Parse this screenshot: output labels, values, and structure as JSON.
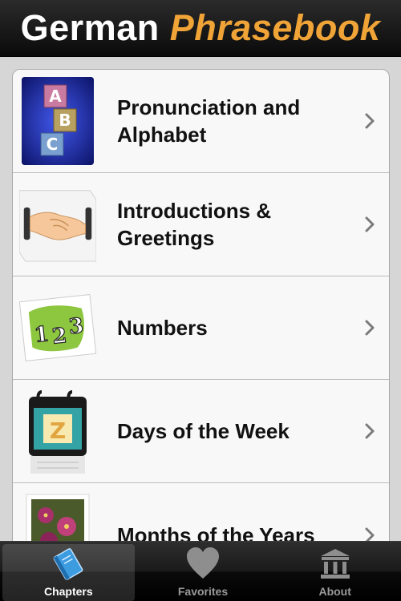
{
  "header": {
    "title_part1": "German",
    "title_part2": "Phrasebook"
  },
  "chapters": [
    {
      "label": "Pronunciation and Alphabet",
      "icon": "abc-blocks-icon"
    },
    {
      "label": "Introductions & Greetings",
      "icon": "handshake-icon"
    },
    {
      "label": "Numbers",
      "icon": "numbers-123-icon"
    },
    {
      "label": "Days of the Week",
      "icon": "calendar-icon"
    },
    {
      "label": "Months of the Years",
      "icon": "flowers-icon"
    }
  ],
  "tabbar": {
    "tabs": [
      {
        "label": "Chapters",
        "icon": "book-icon",
        "active": true
      },
      {
        "label": "Favorites",
        "icon": "heart-icon",
        "active": false
      },
      {
        "label": "About",
        "icon": "building-icon",
        "active": false
      }
    ]
  },
  "colors": {
    "accent_orange": "#f0a437",
    "header_bg": "#111111",
    "list_bg": "#f8f8f8",
    "page_bg": "#d6d6d6"
  }
}
